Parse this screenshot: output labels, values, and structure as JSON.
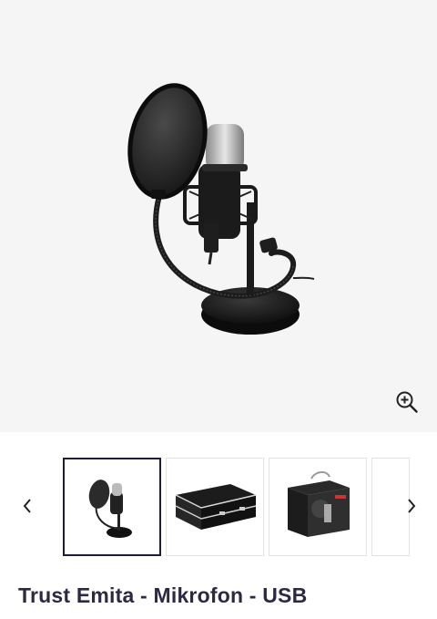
{
  "product": {
    "title": "Trust Emita - Mikrofon - USB",
    "main_image": "studio-microphone-with-pop-filter",
    "selected_thumbnail": 0
  },
  "gallery": {
    "zoom_icon": "zoom-in-icon",
    "prev_icon": "chevron-left-icon",
    "next_icon": "chevron-right-icon",
    "thumbnails": [
      {
        "image": "microphone-on-stand"
      },
      {
        "image": "aluminium-carry-case"
      },
      {
        "image": "product-box"
      },
      {
        "image": "partial-next-thumbnail"
      }
    ]
  },
  "colors": {
    "title": "#2f2844",
    "selected_border": "#1f1b3a",
    "hero_background": "#f5f5f5"
  }
}
